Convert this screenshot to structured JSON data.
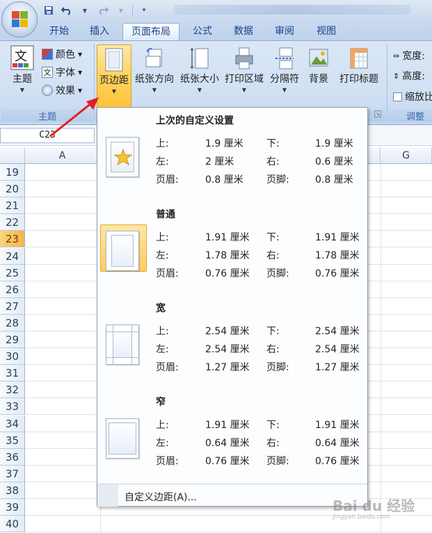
{
  "qat": {
    "undo_icon": "undo-icon",
    "redo_icon": "redo-icon"
  },
  "tabs": [
    "开始",
    "插入",
    "页面布局",
    "公式",
    "数据",
    "审阅",
    "视图"
  ],
  "active_tab": "页面布局",
  "ribbon": {
    "theme_group": {
      "theme_button": "主题",
      "colors": "颜色",
      "fonts": "字体",
      "effects": "效果",
      "label": "主题",
      "theme_icon_text": "文",
      "font_icon_text": "文"
    },
    "page_setup": {
      "margins": "页边距",
      "orientation": "纸张方向",
      "size": "纸张大小",
      "print_area": "打印区域",
      "breaks": "分隔符",
      "background": "背景",
      "print_titles": "打印标题"
    },
    "scale_group": {
      "width": "宽度:",
      "height": "高度:",
      "scale": "缩放比",
      "label": "调整为"
    }
  },
  "name_box": "C23",
  "columns": [
    "A",
    "G"
  ],
  "rows": [
    "19",
    "20",
    "21",
    "22",
    "23",
    "24",
    "25",
    "26",
    "27",
    "28",
    "29",
    "30",
    "31",
    "32",
    "33",
    "34",
    "35",
    "36",
    "37",
    "38",
    "39",
    "40"
  ],
  "selected_row": "23",
  "margins_menu": {
    "presets": [
      {
        "title": "上次的自定义设置",
        "top_label": "上:",
        "top": "1.9 厘米",
        "bottom_label": "下:",
        "bottom": "1.9 厘米",
        "left_label": "左:",
        "left": "2 厘米",
        "right_label": "右:",
        "right": "0.6 厘米",
        "header_label": "页眉:",
        "header": "0.8 厘米",
        "footer_label": "页脚:",
        "footer": "0.8 厘米"
      },
      {
        "title": "普通",
        "top_label": "上:",
        "top": "1.91 厘米",
        "bottom_label": "下:",
        "bottom": "1.91 厘米",
        "left_label": "左:",
        "left": "1.78 厘米",
        "right_label": "右:",
        "right": "1.78 厘米",
        "header_label": "页眉:",
        "header": "0.76 厘米",
        "footer_label": "页脚:",
        "footer": "0.76 厘米"
      },
      {
        "title": "宽",
        "top_label": "上:",
        "top": "2.54 厘米",
        "bottom_label": "下:",
        "bottom": "2.54 厘米",
        "left_label": "左:",
        "left": "2.54 厘米",
        "right_label": "右:",
        "right": "2.54 厘米",
        "header_label": "页眉:",
        "header": "1.27 厘米",
        "footer_label": "页脚:",
        "footer": "1.27 厘米"
      },
      {
        "title": "窄",
        "top_label": "上:",
        "top": "1.91 厘米",
        "bottom_label": "下:",
        "bottom": "1.91 厘米",
        "left_label": "左:",
        "left": "0.64 厘米",
        "right_label": "右:",
        "right": "0.64 厘米",
        "header_label": "页眉:",
        "header": "0.76 厘米",
        "footer_label": "页脚:",
        "footer": "0.76 厘米"
      }
    ],
    "custom_margins": "自定义边距(A)..."
  },
  "watermark": {
    "main": "Bai du 经验",
    "sub": "jingyan.baidu.com"
  },
  "colors": {
    "accent": "#ffc33a",
    "tab_text": "#15428b",
    "arrow": "#e02020"
  }
}
